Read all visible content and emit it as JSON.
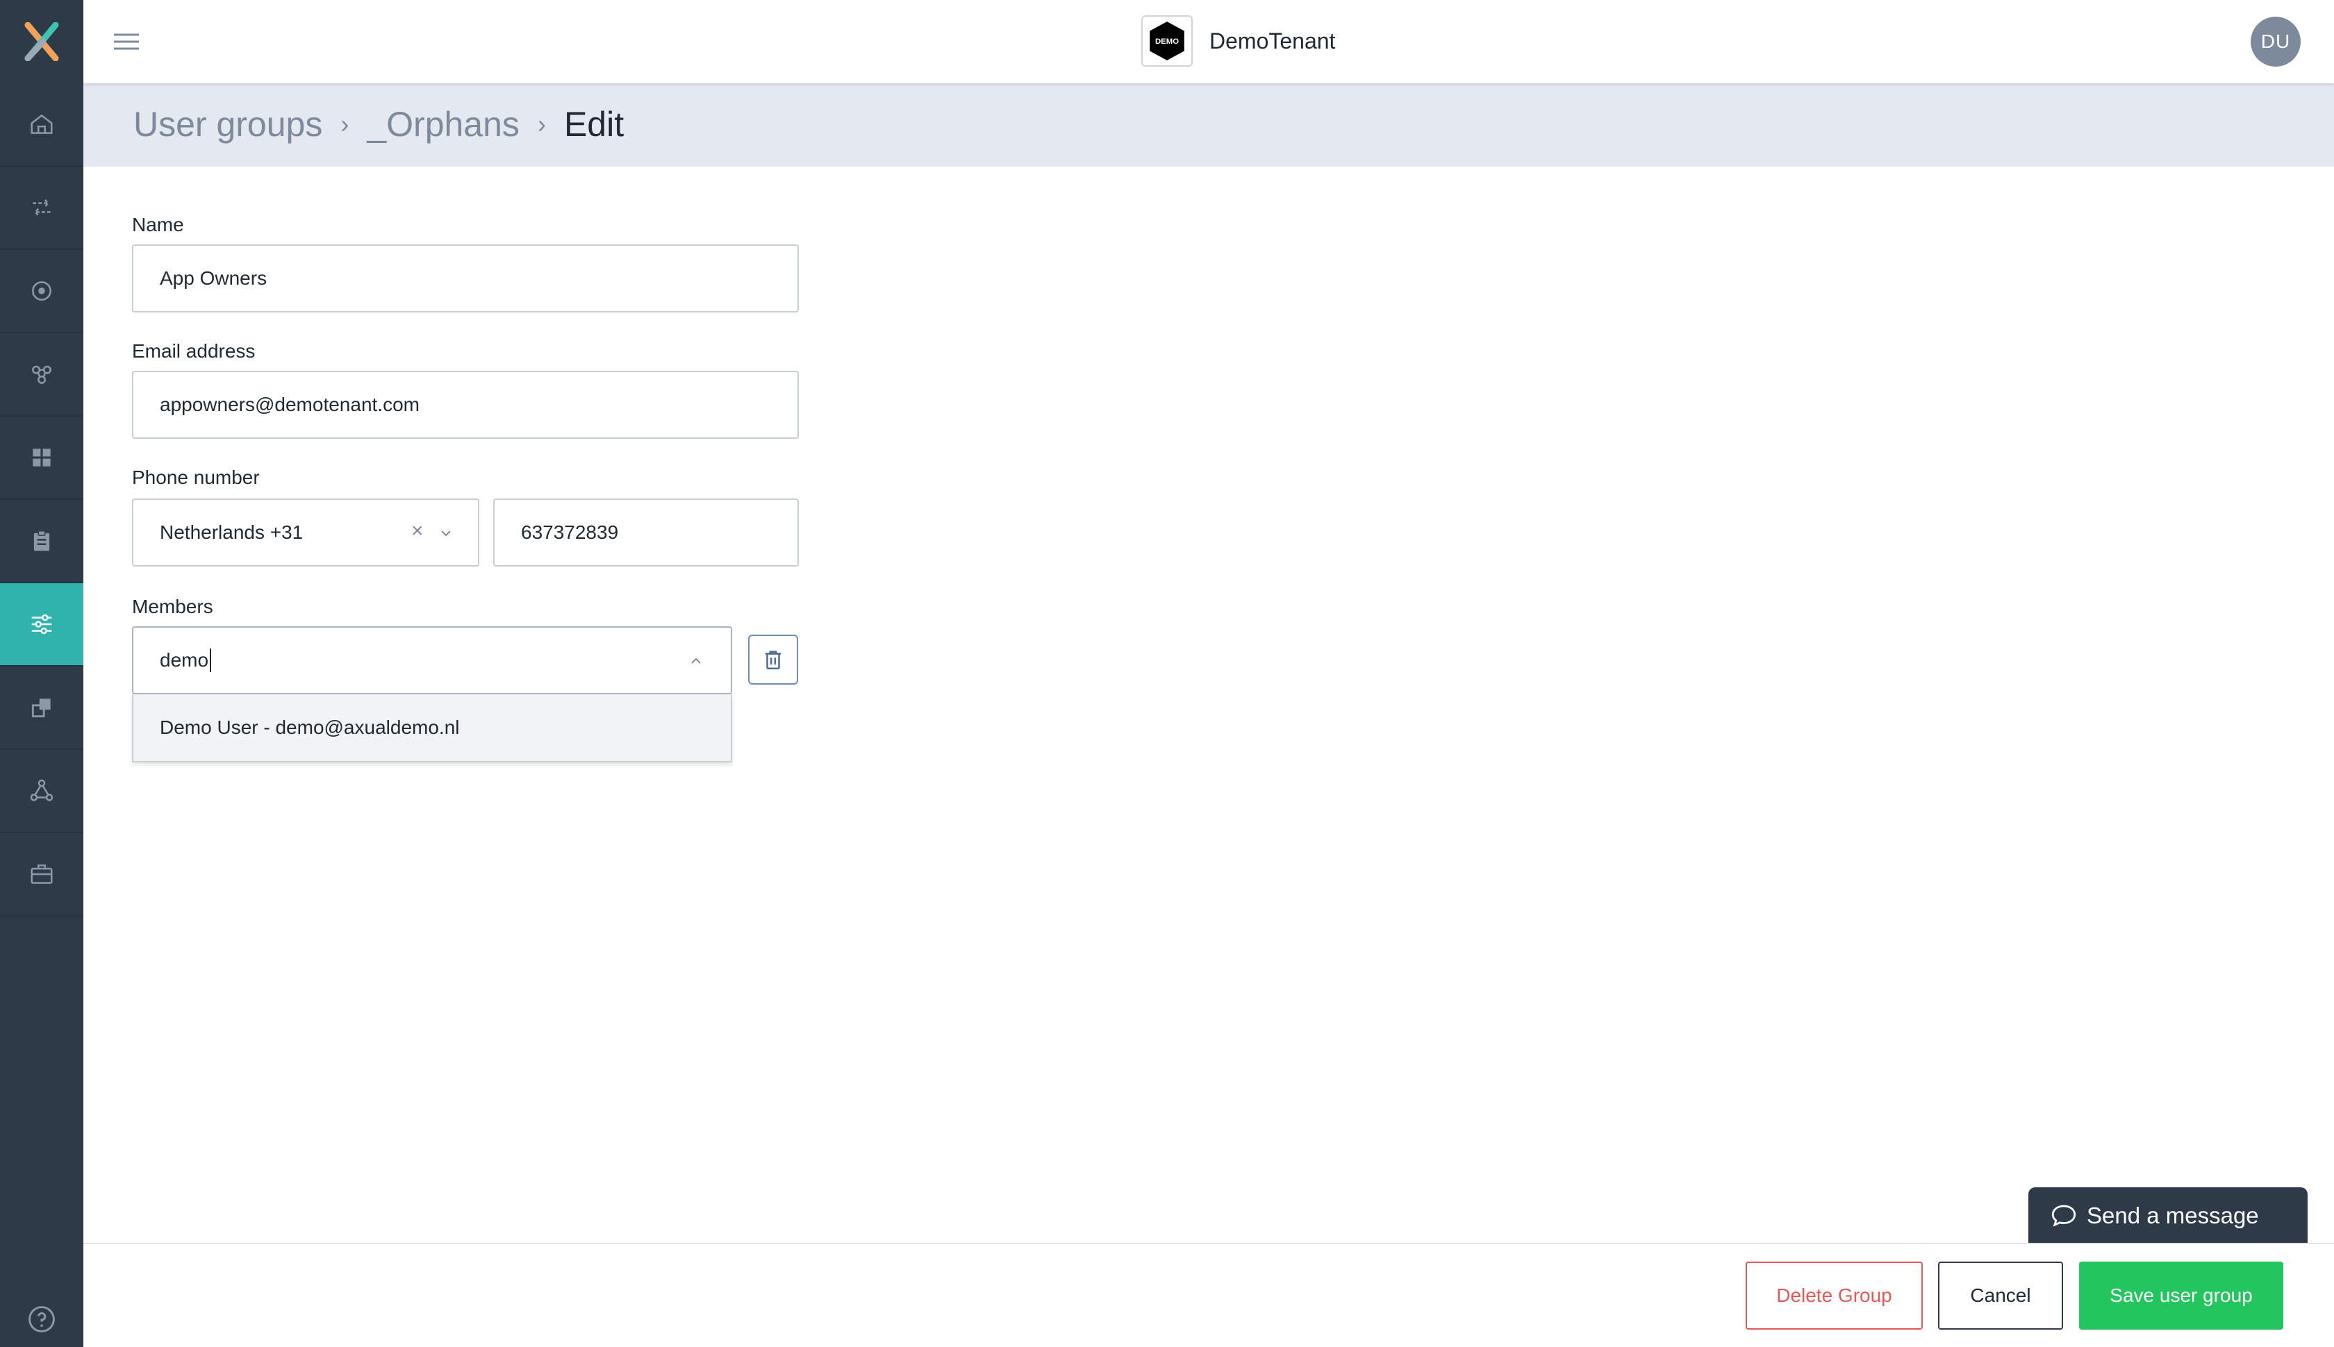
{
  "app": {
    "tenant_logo_text": "DEMO",
    "tenant_name": "DemoTenant",
    "avatar_initials": "DU"
  },
  "sidebar": {
    "items": [
      {
        "name": "home-icon",
        "active": false
      },
      {
        "name": "streams-icon",
        "active": false
      },
      {
        "name": "record-icon",
        "active": false
      },
      {
        "name": "connectors-icon",
        "active": false
      },
      {
        "name": "dashboard-icon",
        "active": false
      },
      {
        "name": "clipboard-icon",
        "active": false
      },
      {
        "name": "settings-sliders-icon",
        "active": true
      },
      {
        "name": "copy-icon",
        "active": false
      },
      {
        "name": "network-icon",
        "active": false
      },
      {
        "name": "briefcase-icon",
        "active": false
      }
    ],
    "help_icon": "help-icon"
  },
  "breadcrumb": {
    "items": [
      "User groups",
      "_Orphans",
      "Edit"
    ]
  },
  "form": {
    "name_label": "Name",
    "name_value": "App Owners",
    "email_label": "Email address",
    "email_value": "appowners@demotenant.com",
    "phone_label": "Phone number",
    "phone_country": "Netherlands +31",
    "phone_number": "637372839",
    "members_label": "Members",
    "members_search": "demo",
    "members_option": "Demo User - demo@axualdemo.nl"
  },
  "footer": {
    "delete_label": "Delete Group",
    "cancel_label": "Cancel",
    "save_label": "Save user group"
  },
  "chat": {
    "label": "Send a message"
  },
  "colors": {
    "sidebar": "#2e3a48",
    "active": "#2fb3ac",
    "save": "#22c55e",
    "delete": "#e05a5a"
  }
}
